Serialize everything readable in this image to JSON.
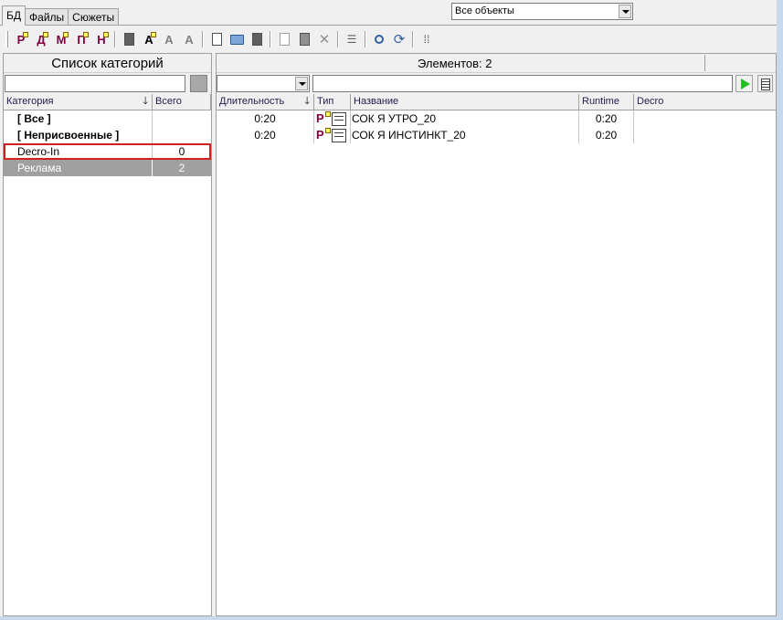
{
  "tabs": [
    {
      "label": "БД",
      "active": true
    },
    {
      "label": "Файлы",
      "active": false
    },
    {
      "label": "Сюжеты",
      "active": false
    }
  ],
  "toolbar": {
    "type_buttons": [
      {
        "letter": "Р",
        "icon": "type-r-icon"
      },
      {
        "letter": "Д",
        "icon": "type-d-icon"
      },
      {
        "letter": "М",
        "icon": "type-m-icon"
      },
      {
        "letter": "П",
        "icon": "type-p-icon"
      },
      {
        "letter": "Н",
        "icon": "type-n-icon"
      }
    ],
    "text_buttons": [
      "A",
      "A",
      "A"
    ],
    "filter_combo": {
      "value": "Все объекты"
    }
  },
  "left": {
    "title": "Список категорий",
    "columns": [
      "Категория",
      "Всего"
    ],
    "sort_indicator": "🡓",
    "rows": [
      {
        "name": "[ Все ]",
        "total": "",
        "bold": true
      },
      {
        "name": "[ Неприсвоенные ]",
        "total": "",
        "bold": true
      },
      {
        "name": "Decro-In",
        "total": "0",
        "bold": false,
        "highlight": true
      },
      {
        "name": "Реклама",
        "total": "2",
        "bold": false,
        "selected": true
      }
    ]
  },
  "right": {
    "count_label": "Элементов: 2",
    "columns": [
      "Длительность",
      "Тип",
      "Название",
      "Runtime",
      "Decro"
    ],
    "sort_indicator": "🡓",
    "rows": [
      {
        "duration": "0:20",
        "type": "Р",
        "name": "СОК Я УТРО_20",
        "runtime": "0:20",
        "decro": ""
      },
      {
        "duration": "0:20",
        "type": "Р",
        "name": "СОК Я ИНСТИНКТ_20",
        "runtime": "0:20",
        "decro": ""
      }
    ]
  },
  "colors": {
    "highlight_border": "#d02020",
    "selected_row": "#a0a0a0",
    "play_green": "#20c020"
  }
}
